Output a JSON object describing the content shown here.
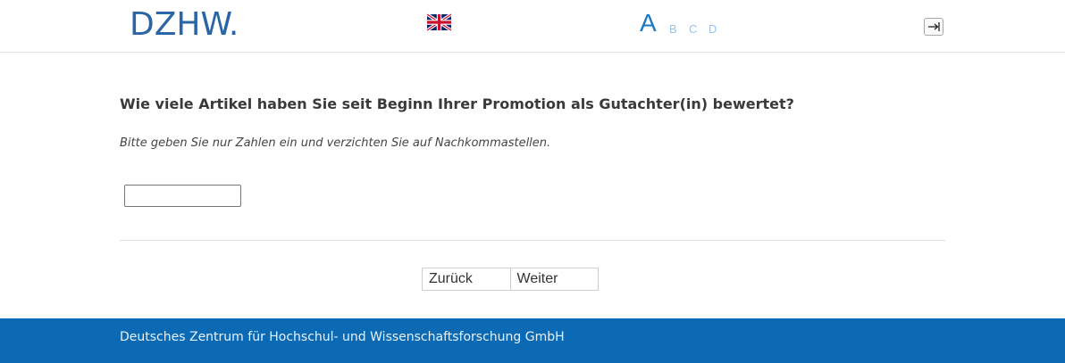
{
  "header": {
    "logo_text": "DZHW.",
    "language_flag_icon": "uk-flag-icon",
    "versions": [
      "A",
      "B",
      "C",
      "D"
    ],
    "active_version": "A",
    "logout_icon": "logout-icon"
  },
  "main": {
    "question": "Wie viele Artikel haben Sie seit Beginn Ihrer Promotion als Gutachter(in) bewertet?",
    "hint": "Bitte geben Sie nur Zahlen ein und verzichten Sie auf Nachkommastellen.",
    "answer_value": ""
  },
  "navigation": {
    "back_label": "Zurück",
    "next_label": "Weiter"
  },
  "footer": {
    "text": "Deutsches Zentrum für Hochschul- und Wissenschaftsforschung GmbH"
  },
  "colors": {
    "brand_blue": "#2a65a8",
    "footer_blue": "#0b6ab3",
    "active_version": "#1a78c2",
    "inactive_version": "#9cc3e6"
  }
}
